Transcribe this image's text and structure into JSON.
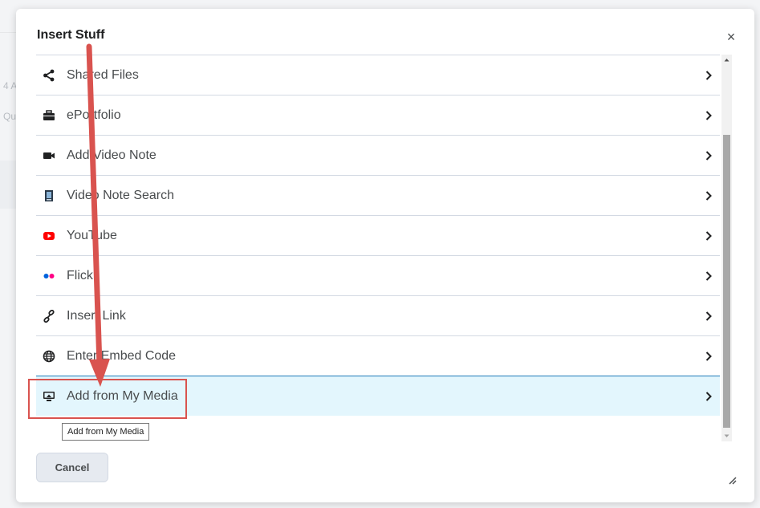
{
  "dialog": {
    "title": "Insert Stuff",
    "close_label": "×",
    "items": [
      {
        "label": "Shared Files",
        "icon": "share-icon"
      },
      {
        "label": "ePortfolio",
        "icon": "briefcase-icon"
      },
      {
        "label": "Add Video Note",
        "icon": "video-camera-icon"
      },
      {
        "label": "Video Note Search",
        "icon": "video-note-search-icon"
      },
      {
        "label": "YouTube",
        "icon": "youtube-icon"
      },
      {
        "label": "Flickr",
        "icon": "flickr-icon"
      },
      {
        "label": "Insert Link",
        "icon": "link-icon"
      },
      {
        "label": "Enter Embed Code",
        "icon": "globe-icon"
      },
      {
        "label": "Add from My Media",
        "icon": "media-icon"
      }
    ],
    "tooltip": "Add from My Media",
    "cancel_label": "Cancel"
  },
  "background": {
    "fragment1": "4 A",
    "fragment2": "Qu"
  },
  "colors": {
    "highlight": "#e3f6fd",
    "annotation": "#d9534f",
    "youtube": "#ff0000",
    "flickr_blue": "#0063dc",
    "flickr_pink": "#ff0084"
  }
}
